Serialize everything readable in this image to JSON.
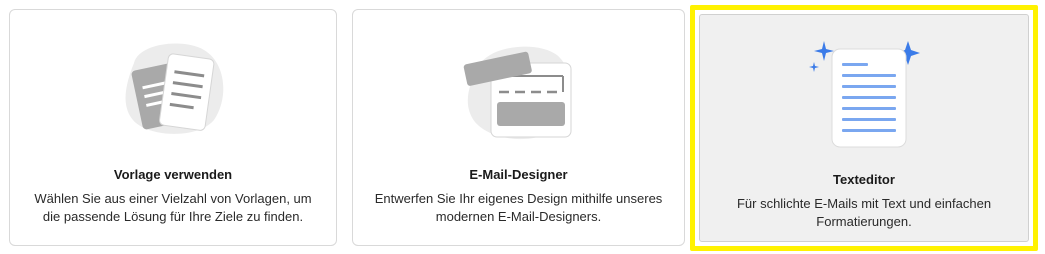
{
  "cards": [
    {
      "title": "Vorlage verwenden",
      "description": "Wählen Sie aus einer Vielzahl von Vorlagen, um die passende Lösung für Ihre Ziele zu finden.",
      "icon": "template-documents-icon",
      "selected": false
    },
    {
      "title": "E-Mail-Designer",
      "description": "Entwerfen Sie Ihr eigenes Design mithilfe unseres modernen E-Mail-Designers.",
      "icon": "email-designer-blocks-icon",
      "selected": false
    },
    {
      "title": "Texteditor",
      "description": "Für schlichte E-Mails mit Text und einfachen Formatierungen.",
      "icon": "text-document-sparkle-icon",
      "selected": true
    }
  ],
  "colors": {
    "highlight": "#fff200",
    "accent_blue": "#3b7be8",
    "line_blue": "#7aa7f0",
    "illustration_gray": "#a8a8a8"
  }
}
